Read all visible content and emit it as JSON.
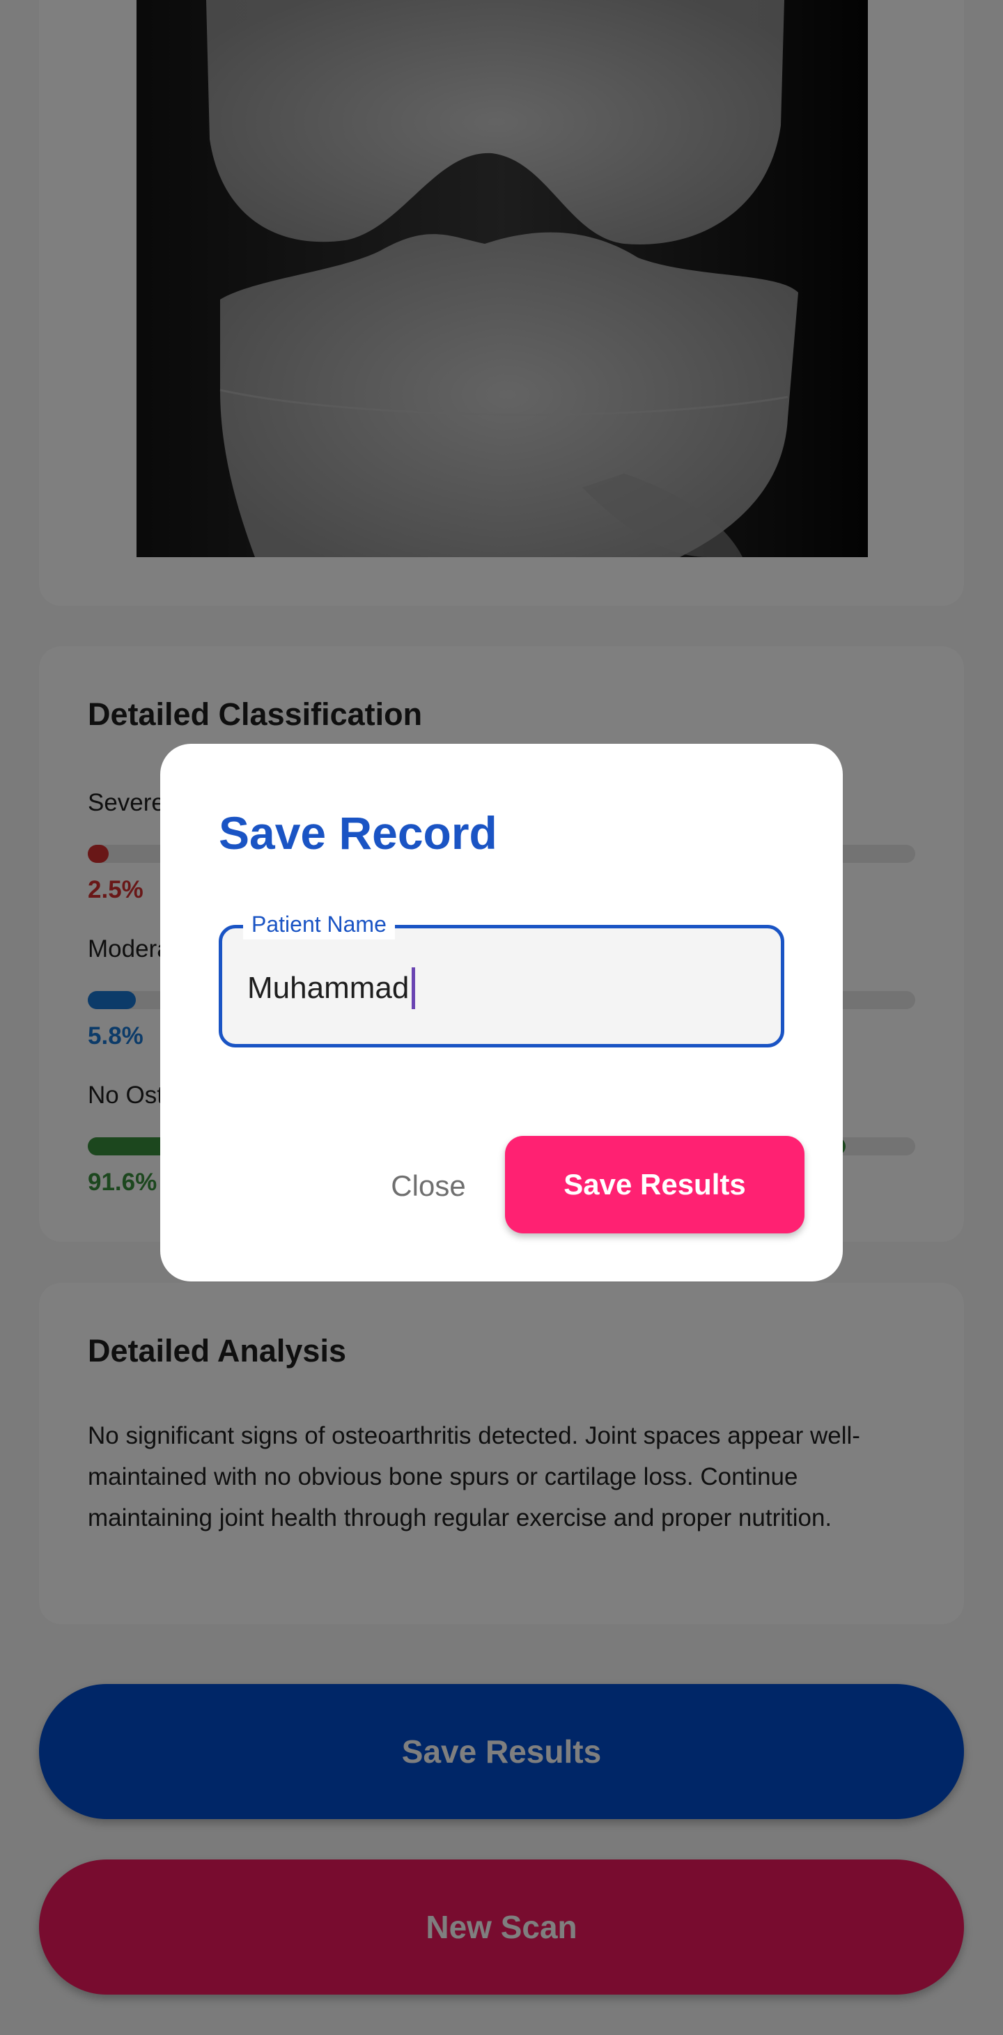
{
  "classification": {
    "title": "Detailed Classification",
    "items": [
      {
        "label": "Severe",
        "percent_text": "2.5%",
        "value": 0.025,
        "color": "#d32f2f"
      },
      {
        "label": "Moderate",
        "percent_text": "5.8%",
        "value": 0.058,
        "color": "#1976d2"
      },
      {
        "label": "No Osteoarthritis",
        "percent_text": "91.6%",
        "value": 0.916,
        "color": "#388e3c"
      }
    ]
  },
  "analysis": {
    "title": "Detailed Analysis",
    "body": "No significant signs of osteoarthritis detected. Joint spaces appear well-maintained with no obvious bone spurs or cartilage loss. Continue maintaining joint health through regular exercise and proper nutrition."
  },
  "buttons": {
    "save_results": "Save Results",
    "new_scan": "New Scan"
  },
  "dialog": {
    "title": "Save Record",
    "field_label": "Patient Name",
    "field_value": "Muhammad",
    "close_label": "Close",
    "save_label": "Save Results"
  },
  "colors": {
    "primary_blue": "#004ccf",
    "accent_pink": "#ff2172",
    "dialog_title": "#1a54c4"
  }
}
